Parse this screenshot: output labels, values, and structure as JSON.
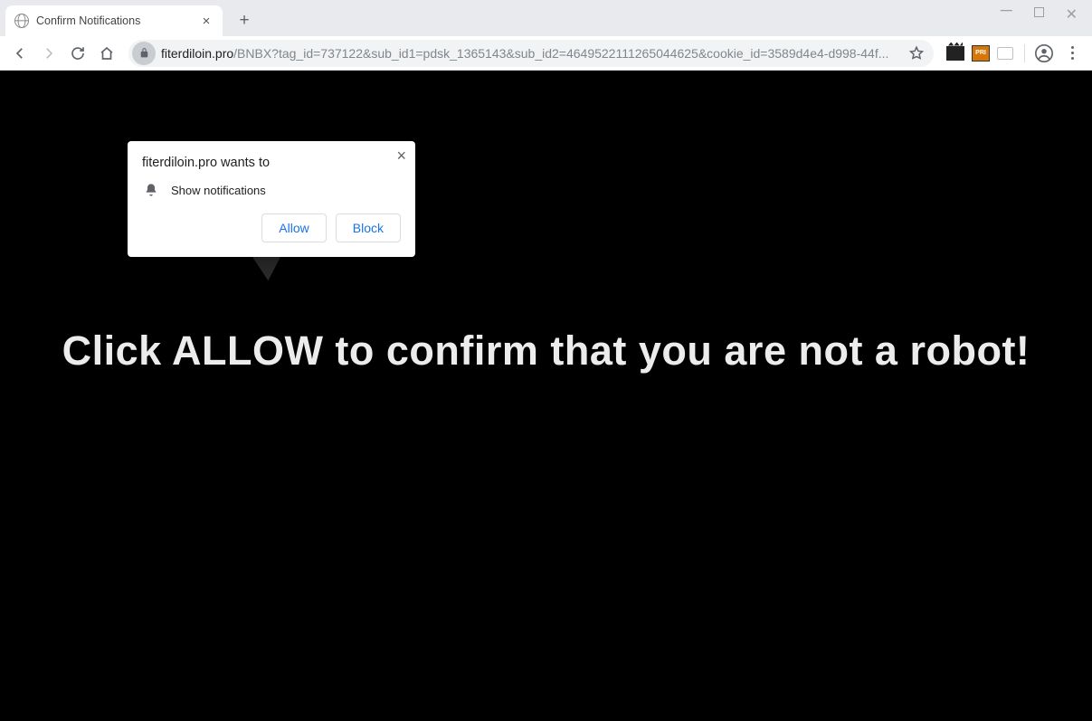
{
  "tab": {
    "title": "Confirm Notifications"
  },
  "omnibox": {
    "domain": "fiterdiloin.pro",
    "path": "/BNBX?tag_id=737122&sub_id1=pdsk_1365143&sub_id2=4649522111265044625&cookie_id=3589d4e4-d998-44f..."
  },
  "ext2_label": "PRI",
  "prompt": {
    "title": "fiterdiloin.pro wants to",
    "permission": "Show notifications",
    "allow": "Allow",
    "block": "Block"
  },
  "page": {
    "headline": "Click ALLOW to confirm that you are not a robot!"
  }
}
